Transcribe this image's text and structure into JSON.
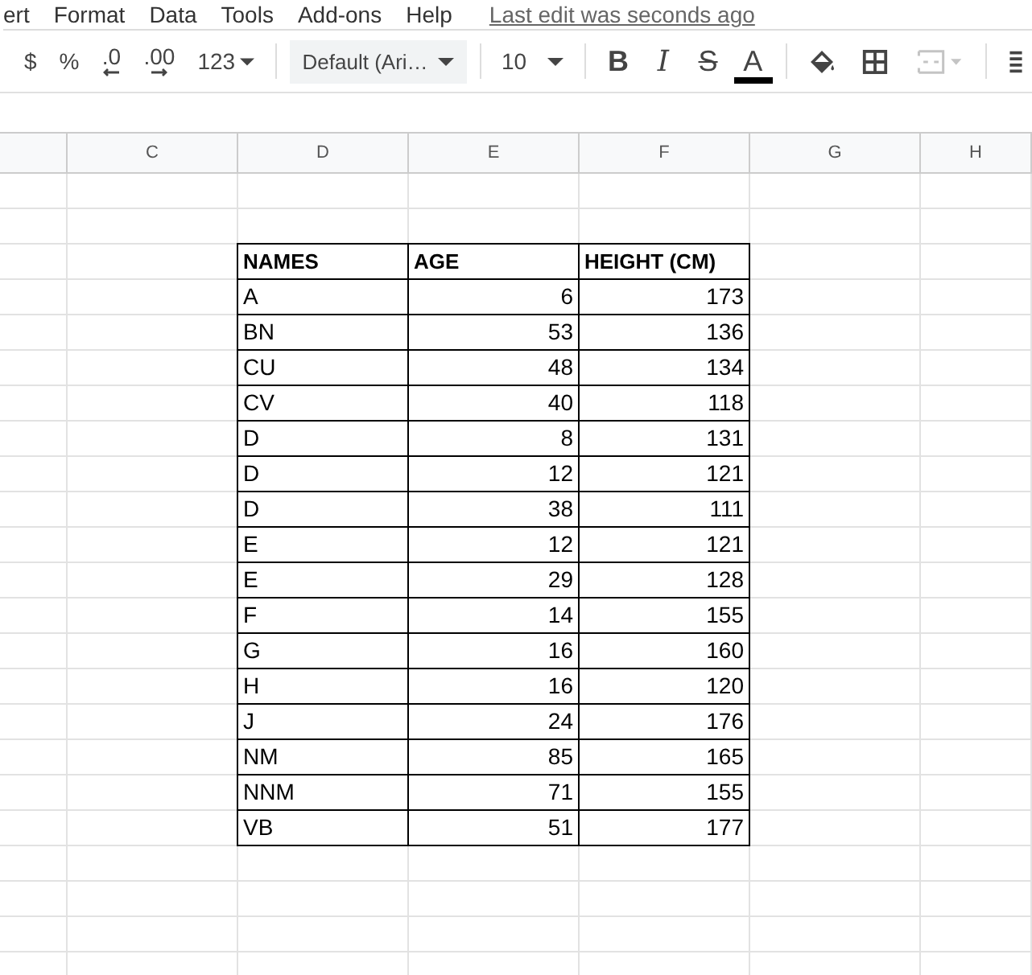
{
  "menu": {
    "items": [
      "ert",
      "Format",
      "Data",
      "Tools",
      "Add-ons",
      "Help"
    ],
    "last_edit": "Last edit was seconds ago"
  },
  "toolbar": [
    {
      "kind": "text",
      "label": "$",
      "disabled": false
    },
    {
      "kind": "text",
      "label": "%",
      "disabled": false
    },
    {
      "kind": "decimal-less",
      "label": ".0",
      "disabled": false
    },
    {
      "kind": "decimal-more",
      "label": ".00",
      "disabled": false
    },
    {
      "kind": "menu",
      "label": "123",
      "disabled": false
    },
    {
      "kind": "separator"
    },
    {
      "kind": "font",
      "label": "Default (Ari…",
      "disabled": false
    },
    {
      "kind": "separator"
    },
    {
      "kind": "size",
      "label": "10",
      "disabled": false
    },
    {
      "kind": "separator"
    },
    {
      "kind": "bold",
      "label": "B",
      "disabled": false
    },
    {
      "kind": "italic",
      "label": "I",
      "disabled": false
    },
    {
      "kind": "strike",
      "label": "S",
      "disabled": false
    },
    {
      "kind": "textcolor",
      "label": "A",
      "disabled": false
    },
    {
      "kind": "separator"
    },
    {
      "kind": "fill",
      "disabled": false
    },
    {
      "kind": "borders",
      "disabled": false
    },
    {
      "kind": "merge",
      "disabled": true
    },
    {
      "kind": "separator"
    },
    {
      "kind": "align",
      "disabled": false
    }
  ],
  "column_headers": [
    "C",
    "D",
    "E",
    "F",
    "G",
    "H"
  ],
  "table": {
    "columns": [
      "NAMES",
      "AGE",
      "HEIGHT (CM)"
    ],
    "rows": [
      [
        "A",
        "6",
        "173"
      ],
      [
        "BN",
        "53",
        "136"
      ],
      [
        "CU",
        "48",
        "134"
      ],
      [
        "CV",
        "40",
        "118"
      ],
      [
        "D",
        "8",
        "131"
      ],
      [
        "D",
        "12",
        "121"
      ],
      [
        "D",
        "38",
        "111"
      ],
      [
        "E",
        "12",
        "121"
      ],
      [
        "E",
        "29",
        "128"
      ],
      [
        "F",
        "14",
        "155"
      ],
      [
        "G",
        "16",
        "160"
      ],
      [
        "H",
        "16",
        "120"
      ],
      [
        "J",
        "24",
        "176"
      ],
      [
        "NM",
        "85",
        "165"
      ],
      [
        "NNM",
        "71",
        "155"
      ],
      [
        "VB",
        "51",
        "177"
      ]
    ]
  }
}
